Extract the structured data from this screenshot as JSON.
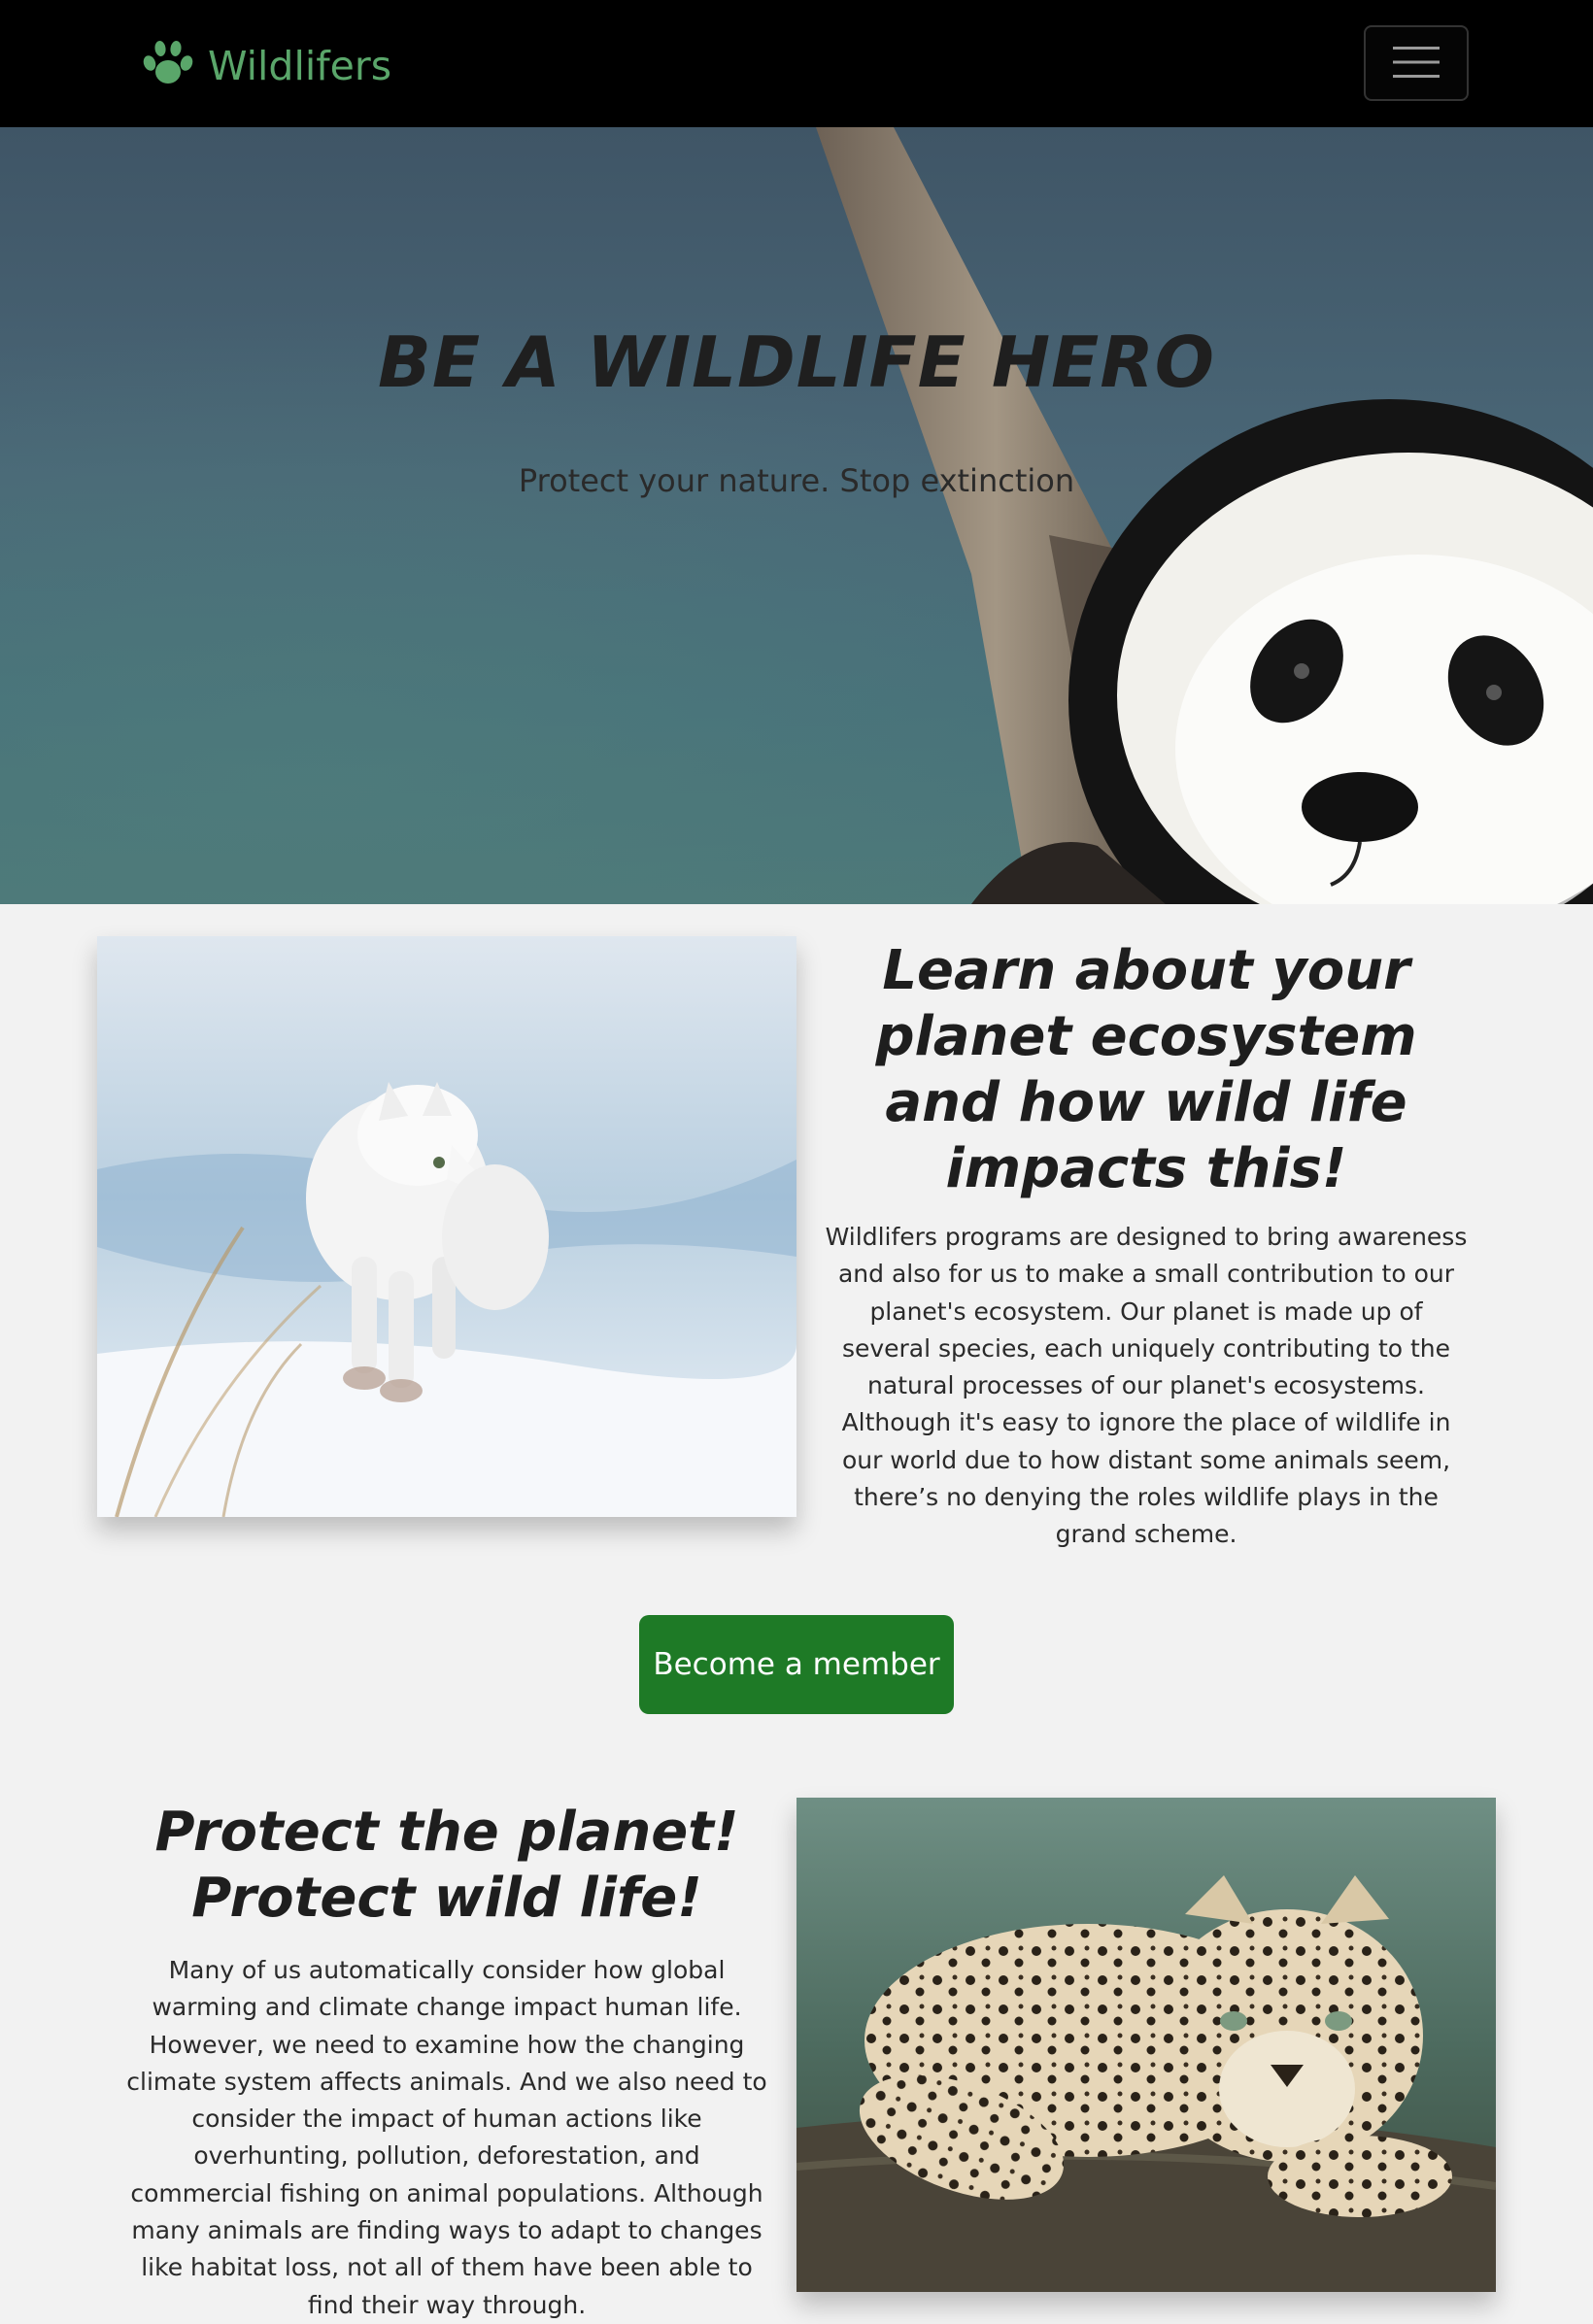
{
  "navbar": {
    "brand": "Wildlifers",
    "brand_icon": "paw-icon",
    "toggle_icon": "hamburger-menu-icon",
    "brand_color": "#5aa66a"
  },
  "hero": {
    "title": "BE A WILDLIFE HERO",
    "subtitle": "Protect your nature. Stop extinction"
  },
  "section1": {
    "image": "arctic-fox-photo",
    "title": "Learn about your planet ecosystem and how wild life impacts this!",
    "body": "Wildlifers programs are designed to bring awareness and also for us to make a small contribution to our planet's ecosystem. Our planet is made up of several species, each uniquely contributing to the natural processes of our planet's ecosystems. Although it's easy to ignore the place of wildlife in our world due to how distant some animals seem, there’s no denying the roles wildlife plays in the grand scheme."
  },
  "cta": {
    "label": "Become a member",
    "color": "#1e7a26"
  },
  "section2": {
    "image": "leopard-photo",
    "title": "Protect the planet! Protect wild life!",
    "body": "Many of us automatically consider how global warming and climate change impact human life. However, we need to examine how the changing climate system affects animals. And we also need to consider the impact of human actions like overhunting, pollution, deforestation, and commercial fishing on animal populations. Although many animals are finding ways to adapt to changes like habitat loss, not all of them have been able to find their way through."
  }
}
